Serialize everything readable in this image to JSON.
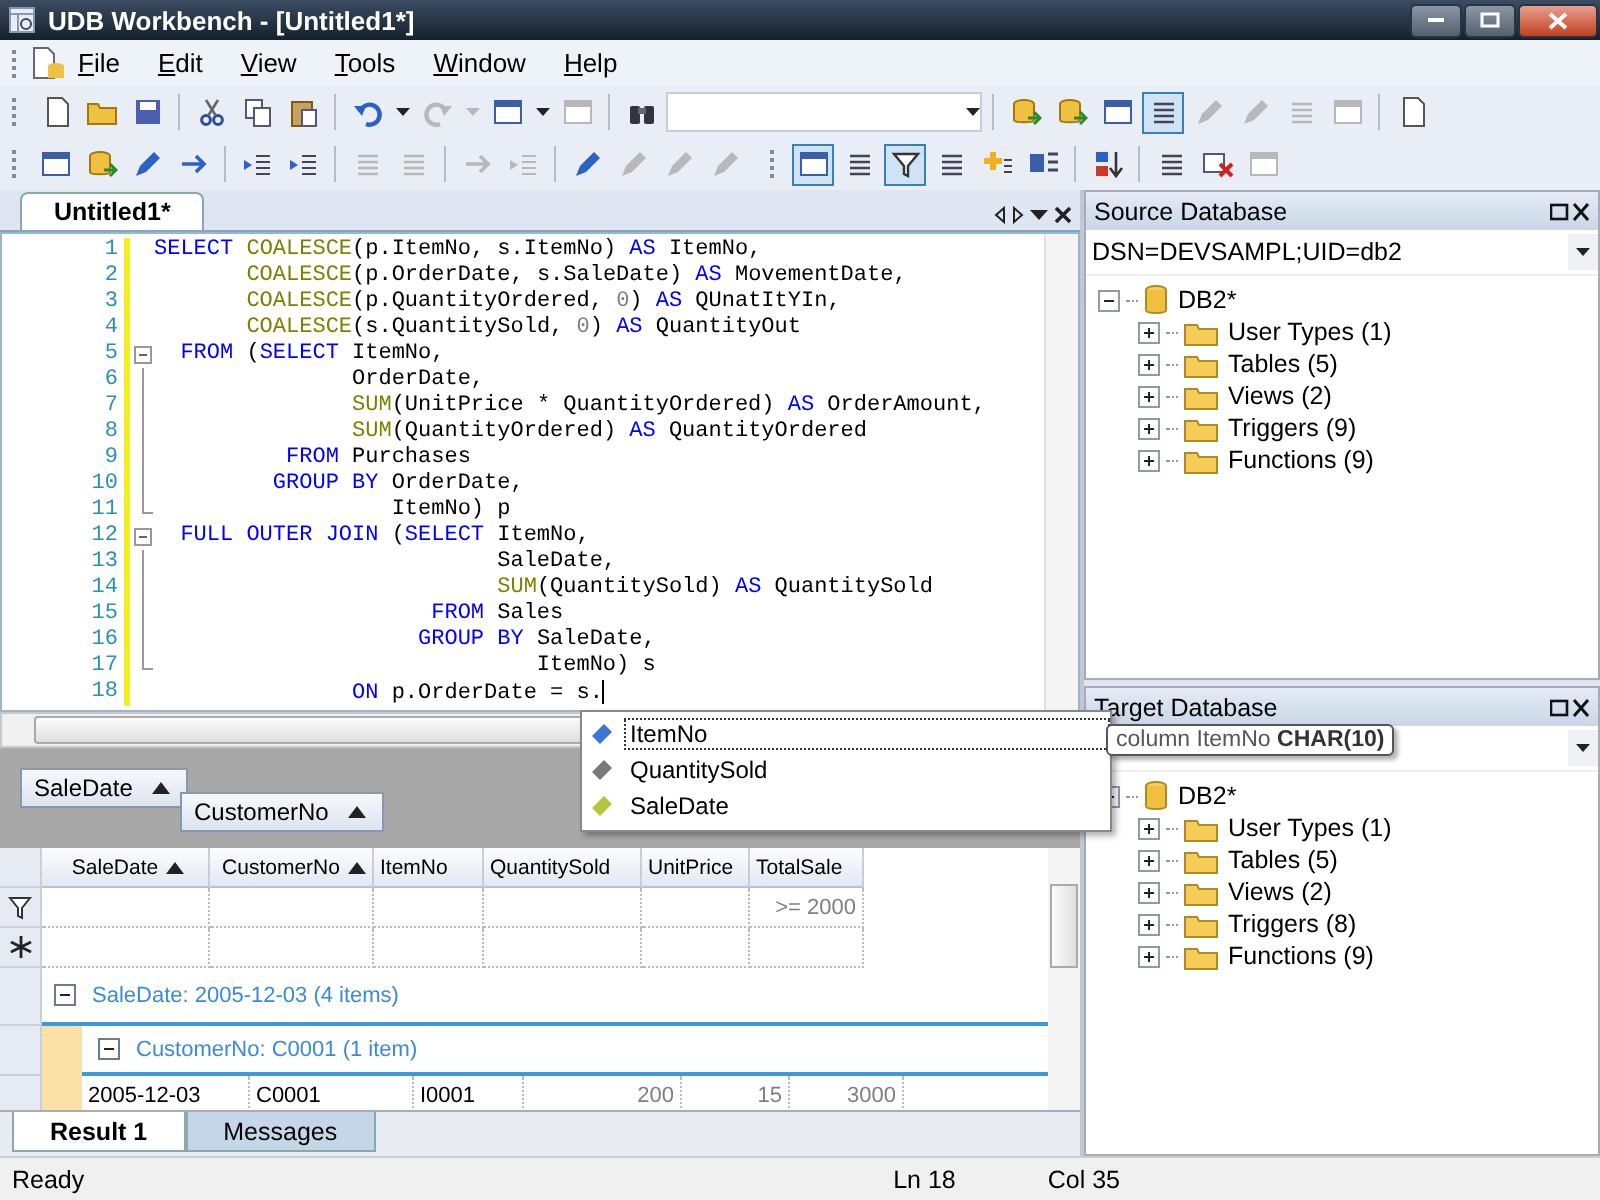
{
  "window": {
    "title": "UDB Workbench - [Untitled1*]"
  },
  "menu": [
    {
      "label": "File"
    },
    {
      "label": "Edit"
    },
    {
      "label": "View"
    },
    {
      "label": "Tools"
    },
    {
      "label": "Window"
    },
    {
      "label": "Help"
    }
  ],
  "toolbar_1": [
    {
      "kind": "document",
      "disabled": false
    },
    {
      "kind": "folder",
      "disabled": false
    },
    {
      "kind": "save",
      "disabled": false
    },
    {
      "kind": "separator"
    },
    {
      "kind": "scissors",
      "disabled": false
    },
    {
      "kind": "copy",
      "disabled": false
    },
    {
      "kind": "paste",
      "disabled": false
    },
    {
      "kind": "separator"
    },
    {
      "kind": "undo",
      "disabled": false
    },
    {
      "kind": "caret",
      "disabled": false
    },
    {
      "kind": "redo",
      "disabled": true
    },
    {
      "kind": "caret",
      "disabled": true
    },
    {
      "kind": "window",
      "disabled": false
    },
    {
      "kind": "caret",
      "disabled": false
    },
    {
      "kind": "window",
      "disabled": true
    },
    {
      "kind": "separator"
    },
    {
      "kind": "binoculars",
      "disabled": false
    },
    {
      "kind": "combo"
    },
    {
      "kind": "separator"
    },
    {
      "kind": "database",
      "disabled": false
    },
    {
      "kind": "database",
      "disabled": false
    },
    {
      "kind": "window",
      "disabled": false
    },
    {
      "kind": "lines",
      "disabled": false,
      "pressed": true
    },
    {
      "kind": "pencil",
      "disabled": true
    },
    {
      "kind": "pencil",
      "disabled": true
    },
    {
      "kind": "lines",
      "disabled": true
    },
    {
      "kind": "window",
      "disabled": true
    },
    {
      "kind": "separator"
    },
    {
      "kind": "document",
      "disabled": false
    }
  ],
  "toolbar_2": [
    {
      "kind": "window",
      "disabled": false
    },
    {
      "kind": "database",
      "disabled": false
    },
    {
      "kind": "pencil",
      "disabled": false
    },
    {
      "kind": "arrow",
      "disabled": false
    },
    {
      "kind": "separator"
    },
    {
      "kind": "indent",
      "disabled": false
    },
    {
      "kind": "indent",
      "disabled": false
    },
    {
      "kind": "separator"
    },
    {
      "kind": "lines",
      "disabled": true
    },
    {
      "kind": "lines",
      "disabled": true
    },
    {
      "kind": "separator"
    },
    {
      "kind": "arrow",
      "disabled": true
    },
    {
      "kind": "indent",
      "disabled": true
    },
    {
      "kind": "separator"
    },
    {
      "kind": "pencil",
      "disabled": false
    },
    {
      "kind": "pencil",
      "disabled": true
    },
    {
      "kind": "pencil",
      "disabled": true
    },
    {
      "kind": "pencil",
      "disabled": true
    },
    {
      "kind": "gap"
    },
    {
      "kind": "window",
      "disabled": false,
      "pressed": true
    },
    {
      "kind": "lines",
      "disabled": false,
      "pressed": false
    },
    {
      "kind": "filter",
      "disabled": false,
      "pressed": true
    },
    {
      "kind": "lines",
      "disabled": false,
      "pressed": false
    },
    {
      "kind": "plus",
      "disabled": false,
      "pressed": false
    },
    {
      "kind": "minus",
      "disabled": false,
      "pressed": false
    },
    {
      "kind": "separator"
    },
    {
      "kind": "sort",
      "disabled": false
    },
    {
      "kind": "separator"
    },
    {
      "kind": "lines",
      "disabled": false
    },
    {
      "kind": "cross",
      "disabled": false
    },
    {
      "kind": "window",
      "disabled": true
    }
  ],
  "document_tabs": [
    {
      "label": "Untitled1*",
      "selected": true
    }
  ],
  "editor": {
    "lines": [
      {
        "number": "1",
        "kind": "plain",
        "tokens": [
          {
            "kind": "keyword",
            "text": "SELECT "
          },
          {
            "kind": "function",
            "text": "COALESCE"
          },
          {
            "kind": "plain",
            "text": "(p.ItemNo, s.ItemNo) "
          },
          {
            "kind": "keyword",
            "text": "AS"
          },
          {
            "kind": "plain",
            "text": " ItemNo,"
          }
        ]
      },
      {
        "number": "2",
        "kind": "plain",
        "tokens": [
          {
            "kind": "function",
            "text": "       COALESCE"
          },
          {
            "kind": "plain",
            "text": "(p.OrderDate, s.SaleDate) "
          },
          {
            "kind": "keyword",
            "text": "AS"
          },
          {
            "kind": "plain",
            "text": " MovementDate,"
          }
        ]
      },
      {
        "number": "3",
        "kind": "plain",
        "tokens": [
          {
            "kind": "function",
            "text": "       COALESCE"
          },
          {
            "kind": "plain",
            "text": "(p.QuantityOrdered, "
          },
          {
            "kind": "number",
            "text": "0"
          },
          {
            "kind": "plain",
            "text": ") "
          },
          {
            "kind": "keyword",
            "text": "AS"
          },
          {
            "kind": "plain",
            "text": " QUnatItYIn,"
          }
        ]
      },
      {
        "number": "4",
        "kind": "plain",
        "tokens": [
          {
            "kind": "function",
            "text": "       COALESCE"
          },
          {
            "kind": "plain",
            "text": "(s.QuantitySold, "
          },
          {
            "kind": "number",
            "text": "0"
          },
          {
            "kind": "plain",
            "text": ") "
          },
          {
            "kind": "keyword",
            "text": "AS"
          },
          {
            "kind": "plain",
            "text": " QuantityOut"
          }
        ]
      },
      {
        "number": "5",
        "kind": "fold_start",
        "tokens": [
          {
            "kind": "keyword",
            "text": "  FROM"
          },
          {
            "kind": "plain",
            "text": " ("
          },
          {
            "kind": "keyword",
            "text": "SELECT"
          },
          {
            "kind": "plain",
            "text": " ItemNo,"
          }
        ]
      },
      {
        "number": "6",
        "kind": "fold_line",
        "tokens": [
          {
            "kind": "plain",
            "text": "               OrderDate,"
          }
        ]
      },
      {
        "number": "7",
        "kind": "fold_line",
        "tokens": [
          {
            "kind": "function",
            "text": "               SUM"
          },
          {
            "kind": "plain",
            "text": "(UnitPrice * QuantityOrdered) "
          },
          {
            "kind": "keyword",
            "text": "AS"
          },
          {
            "kind": "plain",
            "text": " OrderAmount,"
          }
        ]
      },
      {
        "number": "8",
        "kind": "fold_line",
        "tokens": [
          {
            "kind": "function",
            "text": "               SUM"
          },
          {
            "kind": "plain",
            "text": "(QuantityOrdered) "
          },
          {
            "kind": "keyword",
            "text": "AS"
          },
          {
            "kind": "plain",
            "text": " QuantityOrdered"
          }
        ]
      },
      {
        "number": "9",
        "kind": "fold_line",
        "tokens": [
          {
            "kind": "keyword",
            "text": "          FROM"
          },
          {
            "kind": "plain",
            "text": " Purchases"
          }
        ]
      },
      {
        "number": "10",
        "kind": "fold_line",
        "tokens": [
          {
            "kind": "keyword",
            "text": "         GROUP BY"
          },
          {
            "kind": "plain",
            "text": " OrderDate,"
          }
        ]
      },
      {
        "number": "11",
        "kind": "fold_end",
        "tokens": [
          {
            "kind": "plain",
            "text": "                  ItemNo) p"
          }
        ]
      },
      {
        "number": "12",
        "kind": "fold_start",
        "tokens": [
          {
            "kind": "keyword",
            "text": "  FULL OUTER JOIN"
          },
          {
            "kind": "plain",
            "text": " ("
          },
          {
            "kind": "keyword",
            "text": "SELECT"
          },
          {
            "kind": "plain",
            "text": " ItemNo,"
          }
        ]
      },
      {
        "number": "13",
        "kind": "fold_line",
        "tokens": [
          {
            "kind": "plain",
            "text": "                          SaleDate,"
          }
        ]
      },
      {
        "number": "14",
        "kind": "fold_line",
        "tokens": [
          {
            "kind": "function",
            "text": "                          SUM"
          },
          {
            "kind": "plain",
            "text": "(QuantitySold) "
          },
          {
            "kind": "keyword",
            "text": "AS"
          },
          {
            "kind": "plain",
            "text": " QuantitySold"
          }
        ]
      },
      {
        "number": "15",
        "kind": "fold_line",
        "tokens": [
          {
            "kind": "keyword",
            "text": "                     FROM"
          },
          {
            "kind": "plain",
            "text": " Sales"
          }
        ]
      },
      {
        "number": "16",
        "kind": "fold_line",
        "tokens": [
          {
            "kind": "keyword",
            "text": "                    GROUP BY"
          },
          {
            "kind": "plain",
            "text": " SaleDate,"
          }
        ]
      },
      {
        "number": "17",
        "kind": "fold_end",
        "tokens": [
          {
            "kind": "plain",
            "text": "                             ItemNo) s"
          }
        ]
      },
      {
        "number": "18",
        "kind": "plain",
        "cursor": true,
        "tokens": [
          {
            "kind": "keyword",
            "text": "               ON"
          },
          {
            "kind": "plain",
            "text": " p.OrderDate = s."
          }
        ]
      }
    ]
  },
  "autocomplete": {
    "items": [
      {
        "label": "ItemNo",
        "color": "#3a78d4",
        "selected": true
      },
      {
        "label": "QuantitySold",
        "color": "#7a7a7a",
        "selected": false
      },
      {
        "label": "SaleDate",
        "color": "#b5c63c",
        "selected": false
      }
    ]
  },
  "tooltip": {
    "text": "column ItemNo **CHAR(10)**"
  },
  "results": {
    "group_by": [
      {
        "label": "SaleDate"
      },
      {
        "label": "CustomerNo"
      }
    ],
    "columns": [
      {
        "label": "SaleDate",
        "sorted": true
      },
      {
        "label": "CustomerNo",
        "sorted": true
      },
      {
        "label": "ItemNo",
        "sorted": false
      },
      {
        "label": "QuantitySold",
        "sorted": false
      },
      {
        "label": "UnitPrice",
        "sorted": false
      },
      {
        "label": "TotalSale",
        "sorted": false,
        "filter": ">= 2000"
      }
    ],
    "groups": [
      {
        "label": "SaleDate: 2005-12-03 (4 items)",
        "expanded": true,
        "children": [
          {
            "label": "CustomerNo: C0001 (1 item)",
            "expanded": true,
            "rows": [
              [
                "2005-12-03",
                "C0001",
                "I0001",
                "200",
                "15",
                "3000"
              ]
            ]
          }
        ]
      }
    ],
    "tabs": [
      {
        "label": "Result 1",
        "selected": true
      },
      {
        "label": "Messages",
        "selected": false
      }
    ]
  },
  "source_database": {
    "title": "Source Database",
    "connection": "DSN=DEVSAMPL;UID=db2",
    "tree": {
      "label": "DB2*",
      "expanded": true,
      "children": [
        {
          "label": "User Types (1)",
          "expanded": false
        },
        {
          "label": "Tables (5)",
          "expanded": false
        },
        {
          "label": "Views (2)",
          "expanded": false
        },
        {
          "label": "Triggers (9)",
          "expanded": false
        },
        {
          "label": "Functions (9)",
          "expanded": false
        }
      ]
    }
  },
  "target_database": {
    "title": "Target Database",
    "tree": {
      "label": "DB2*",
      "children": [
        {
          "label": "User Types (1)",
          "expanded": false
        },
        {
          "label": "Tables (5)",
          "expanded": false
        },
        {
          "label": "Views (2)",
          "expanded": false
        },
        {
          "label": "Triggers (8)",
          "expanded": false
        },
        {
          "label": "Functions (9)",
          "expanded": false
        }
      ]
    }
  },
  "status_bar": {
    "message": "Ready",
    "line": "Ln 18",
    "column": "Col 35"
  }
}
